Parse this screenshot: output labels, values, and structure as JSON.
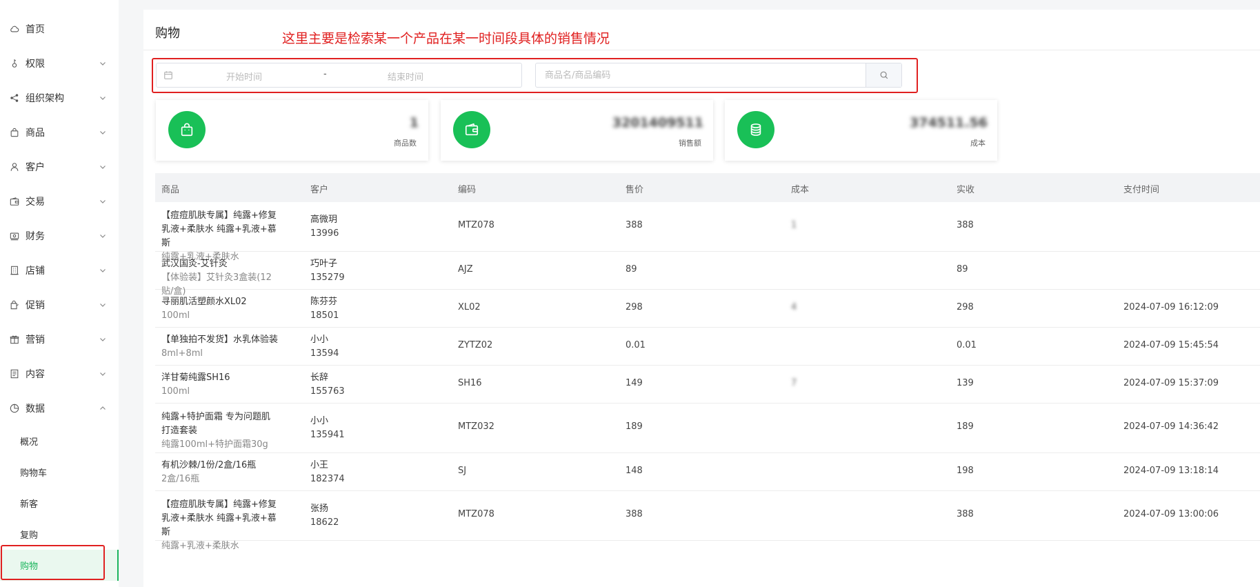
{
  "sidebar": {
    "items": [
      {
        "label": "首页",
        "icon": "cloud-icon",
        "has_chevron": false
      },
      {
        "label": "权限",
        "icon": "key-icon",
        "has_chevron": true
      },
      {
        "label": "组织架构",
        "icon": "share-icon",
        "has_chevron": true
      },
      {
        "label": "商品",
        "icon": "bag-icon",
        "has_chevron": true
      },
      {
        "label": "客户",
        "icon": "user-icon",
        "has_chevron": true
      },
      {
        "label": "交易",
        "icon": "wallet-icon",
        "has_chevron": true
      },
      {
        "label": "财务",
        "icon": "money-icon",
        "has_chevron": true
      },
      {
        "label": "店铺",
        "icon": "building-icon",
        "has_chevron": true
      },
      {
        "label": "促销",
        "icon": "promo-bag-icon",
        "has_chevron": true
      },
      {
        "label": "营销",
        "icon": "gift-icon",
        "has_chevron": true
      },
      {
        "label": "内容",
        "icon": "document-icon",
        "has_chevron": true
      },
      {
        "label": "数据",
        "icon": "pie-chart-icon",
        "has_chevron": true,
        "expanded": true
      }
    ],
    "sub_items": [
      {
        "label": "概况",
        "active": false
      },
      {
        "label": "购物车",
        "active": false
      },
      {
        "label": "新客",
        "active": false
      },
      {
        "label": "复购",
        "active": false
      },
      {
        "label": "购物",
        "active": true
      }
    ]
  },
  "header": {
    "title": "购物",
    "annotation": "这里主要是检索某一个产品在某一时间段具体的销售情况"
  },
  "filters": {
    "start_placeholder": "开始时间",
    "separator": "-",
    "end_placeholder": "结束时间",
    "search_placeholder": "商品名/商品编码"
  },
  "stats": [
    {
      "icon": "bag-icon",
      "value": "1",
      "label": "商品数"
    },
    {
      "icon": "wallet-icon",
      "value": "3201409511",
      "label": "销售额"
    },
    {
      "icon": "coins-icon",
      "value": "374511.56",
      "label": "成本"
    }
  ],
  "table": {
    "headers": [
      "商品",
      "客户",
      "编码",
      "售价",
      "成本",
      "实收",
      "支付时间"
    ],
    "rows": [
      {
        "product": "【痘痘肌肤专属】纯露+修复乳液+柔肤水 纯露+乳液+慕斯",
        "spec": "纯露+乳液+柔肤水",
        "customer": "高微玥",
        "phone": "13996",
        "code": "MTZ078",
        "price": "388",
        "cost": "1",
        "paid": "388",
        "time": ""
      },
      {
        "product": "武汉国灸-艾针灸",
        "spec": "【体验装】艾针灸3盒装(12贴/盒)",
        "customer": "巧叶子",
        "phone": "135279",
        "code": "AJZ",
        "price": "89",
        "cost": "",
        "paid": "89",
        "time": ""
      },
      {
        "product": "寻丽肌活塑颜水XL02",
        "spec": "100ml",
        "customer": "陈芬芬",
        "phone": "18501",
        "code": "XL02",
        "price": "298",
        "cost": "4",
        "paid": "298",
        "time": "2024-07-09 16:12:09"
      },
      {
        "product": "【单独拍不发货】水乳体验装",
        "spec": "8ml+8ml",
        "customer": "小小",
        "phone": "13594",
        "code": "ZYTZ02",
        "price": "0.01",
        "cost": "",
        "paid": "0.01",
        "time": "2024-07-09 15:45:54"
      },
      {
        "product": "洋甘菊纯露SH16",
        "spec": "100ml",
        "customer": "长辞",
        "phone": "155763",
        "code": "SH16",
        "price": "149",
        "cost": "7",
        "paid": "139",
        "time": "2024-07-09 15:37:09"
      },
      {
        "product": "纯露+特护面霜 专为问题肌打造套装",
        "spec": "纯露100ml+特护面霜30g",
        "customer": "小小",
        "phone": "135941",
        "code": "MTZ032",
        "price": "189",
        "cost": "",
        "paid": "189",
        "time": "2024-07-09 14:36:42"
      },
      {
        "product": "有机沙棘/1份/2盒/16瓶",
        "spec": "2盒/16瓶",
        "customer": "小王",
        "phone": "182374",
        "code": "SJ",
        "price": "148",
        "cost": "",
        "paid": "198",
        "time": "2024-07-09 13:18:14"
      },
      {
        "product": "【痘痘肌肤专属】纯露+修复乳液+柔肤水 纯露+乳液+慕斯",
        "spec": "纯露+乳液+柔肤水",
        "customer": "张扬",
        "phone": "18622",
        "code": "MTZ078",
        "price": "388",
        "cost": "",
        "paid": "388",
        "time": "2024-07-09 13:00:06"
      }
    ]
  },
  "colors": {
    "accent": "#19c057",
    "annotation": "#e02020"
  }
}
